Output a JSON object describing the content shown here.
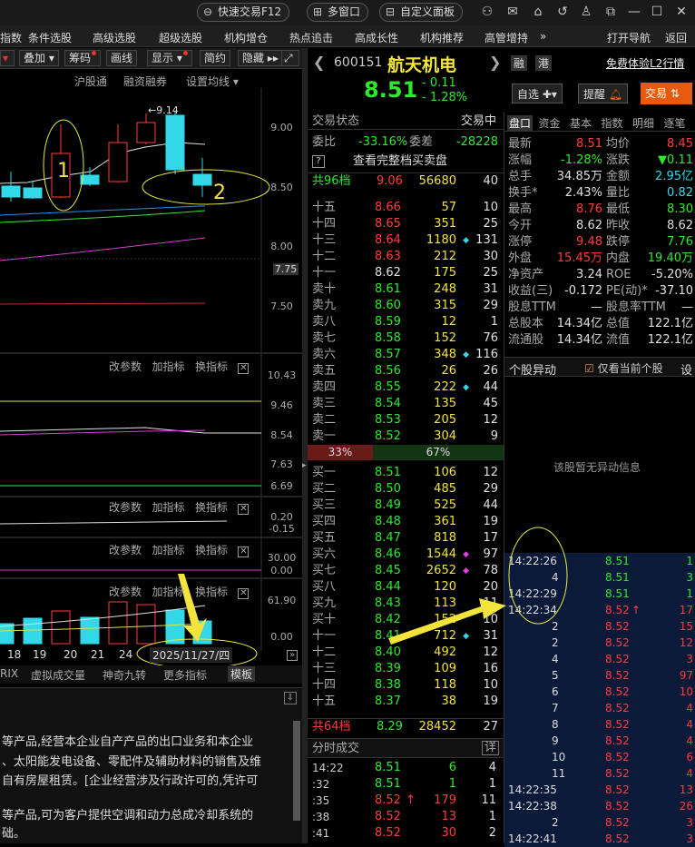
{
  "topbar": {
    "quick_trade": "快速交易F12",
    "multi_window": "多窗口",
    "custom_panel": "自定义面板"
  },
  "menu": [
    "指数",
    "条件选股",
    "高级选股",
    "超级选股",
    "机构增仓",
    "热点追击",
    "高成长性",
    "机构推荐",
    "高管增持",
    "打开导航",
    "返回"
  ],
  "left_toolbar": {
    "overlay": "叠加",
    "chips": "筹码",
    "draw": "画线",
    "display": "显示",
    "simple": "简约",
    "hide": "隐藏"
  },
  "chart_header": {
    "hgt": "沪股通",
    "margin": "融资融券",
    "set_ma": "设置均线"
  },
  "chart_data": [
    {
      "type": "candlestick",
      "y_ticks": [
        "9.00",
        "8.50",
        "8.00",
        "7.75",
        "7.50"
      ],
      "high_label": "9.14",
      "annotations": [
        "1",
        "2"
      ]
    },
    {
      "type": "line",
      "y_ticks": [
        "10.43",
        "9.46",
        "8.54",
        "7.63",
        "6.69"
      ]
    },
    {
      "type": "line",
      "y_ticks": [
        "0.20",
        "-0.15"
      ]
    },
    {
      "type": "line",
      "y_ticks": [
        "30.00",
        "0.00"
      ]
    },
    {
      "type": "bar",
      "y_ticks": [
        "61.90",
        "0.00"
      ],
      "x_ticks": [
        "18",
        "19",
        "20",
        "21",
        "24"
      ],
      "date_label": "2025/11/27/四"
    }
  ],
  "indicator_panel": {
    "change_param": "改参数",
    "add_indicator": "加指标",
    "switch_indicator": "换指标"
  },
  "bottom_tabs": [
    "RIX",
    "虚拟成交量",
    "神奇九转",
    "更多指标",
    "模板"
  ],
  "info_lines": [
    "等产品,经营本企业自产产品的出口业务和本企业",
    "、太阳能发电设备、零配件及辅助材料的销售及维",
    "自有房屋租赁。[企业经营涉及行政许可的,凭许可",
    "等产品,可为客户提供空调和动力总成冷却系统的",
    "础。"
  ],
  "stock": {
    "code": "600151",
    "name": "航天机电",
    "price": "8.51",
    "change": "- 0.11",
    "pct": "- 1.28%",
    "rong": "融",
    "gang": "港",
    "l2": "免费体验L2行情",
    "zixuan": "自选",
    "tixing": "提醒",
    "jiaoyi": "交易"
  },
  "quote_header": {
    "state_label": "交易状态",
    "state": "交易中",
    "weibi_label": "委比",
    "weibi": "-33.16%",
    "weicha_label": "委差",
    "weicha": "-28228",
    "full_depth": "查看完整档买卖盘",
    "top_label": "共96档",
    "top_price": "9.06",
    "top_vol": "56680",
    "top_n": "40"
  },
  "sells": [
    {
      "l": "十五",
      "p": "8.66",
      "v": "57",
      "n": "10",
      "m": ""
    },
    {
      "l": "十四",
      "p": "8.65",
      "v": "351",
      "n": "25",
      "m": ""
    },
    {
      "l": "十三",
      "p": "8.64",
      "v": "1180",
      "n": "131",
      "m": "c"
    },
    {
      "l": "十二",
      "p": "8.63",
      "v": "212",
      "n": "30",
      "m": ""
    },
    {
      "l": "十一",
      "p": "8.62",
      "v": "175",
      "n": "25",
      "m": ""
    },
    {
      "l": "卖十",
      "p": "8.61",
      "v": "248",
      "n": "31",
      "m": ""
    },
    {
      "l": "卖九",
      "p": "8.60",
      "v": "315",
      "n": "29",
      "m": ""
    },
    {
      "l": "卖八",
      "p": "8.59",
      "v": "12",
      "n": "1",
      "m": ""
    },
    {
      "l": "卖七",
      "p": "8.58",
      "v": "152",
      "n": "76",
      "m": ""
    },
    {
      "l": "卖六",
      "p": "8.57",
      "v": "348",
      "n": "116",
      "m": "c"
    },
    {
      "l": "卖五",
      "p": "8.56",
      "v": "26",
      "n": "26",
      "m": ""
    },
    {
      "l": "卖四",
      "p": "8.55",
      "v": "222",
      "n": "44",
      "m": "c"
    },
    {
      "l": "卖三",
      "p": "8.54",
      "v": "135",
      "n": "45",
      "m": ""
    },
    {
      "l": "卖二",
      "p": "8.53",
      "v": "205",
      "n": "12",
      "m": ""
    },
    {
      "l": "卖一",
      "p": "8.52",
      "v": "304",
      "n": "9",
      "m": ""
    }
  ],
  "ratio": {
    "buy": "33%",
    "sell": "67%"
  },
  "buys": [
    {
      "l": "买一",
      "p": "8.51",
      "v": "106",
      "n": "12",
      "m": ""
    },
    {
      "l": "买二",
      "p": "8.50",
      "v": "485",
      "n": "29",
      "m": ""
    },
    {
      "l": "买三",
      "p": "8.49",
      "v": "525",
      "n": "44",
      "m": ""
    },
    {
      "l": "买四",
      "p": "8.48",
      "v": "361",
      "n": "19",
      "m": ""
    },
    {
      "l": "买五",
      "p": "8.47",
      "v": "818",
      "n": "17",
      "m": ""
    },
    {
      "l": "买六",
      "p": "8.46",
      "v": "1544",
      "n": "97",
      "m": "m"
    },
    {
      "l": "买七",
      "p": "8.45",
      "v": "2652",
      "n": "78",
      "m": "m"
    },
    {
      "l": "买八",
      "p": "8.44",
      "v": "120",
      "n": "20",
      "m": ""
    },
    {
      "l": "买九",
      "p": "8.43",
      "v": "113",
      "n": "11",
      "m": ""
    },
    {
      "l": "买十",
      "p": "8.42",
      "v": "152",
      "n": "10",
      "m": ""
    },
    {
      "l": "十一",
      "p": "8.41",
      "v": "712",
      "n": "31",
      "m": "c"
    },
    {
      "l": "十二",
      "p": "8.40",
      "v": "492",
      "n": "12",
      "m": ""
    },
    {
      "l": "十三",
      "p": "8.39",
      "v": "109",
      "n": "16",
      "m": ""
    },
    {
      "l": "十四",
      "p": "8.38",
      "v": "118",
      "n": "10",
      "m": ""
    },
    {
      "l": "十五",
      "p": "8.37",
      "v": "38",
      "n": "19",
      "m": ""
    }
  ],
  "bottom_level": {
    "label": "共64档",
    "price": "8.29",
    "vol": "28452",
    "n": "27"
  },
  "fenshi": {
    "title": "分时成交",
    "detail": "详",
    "rows": [
      {
        "t": "14:22",
        "p": "8.51",
        "v": "6",
        "n": "4",
        "arrow": ""
      },
      {
        "t": ":32",
        "p": "8.51",
        "v": "1",
        "n": "1",
        "arrow": ""
      },
      {
        "t": ":35",
        "p": "8.52",
        "v": "179",
        "n": "11",
        "arrow": "↑"
      },
      {
        "t": ":38",
        "p": "8.52",
        "v": "13",
        "n": "1",
        "arrow": ""
      },
      {
        "t": ":41",
        "p": "8.52",
        "v": "30",
        "n": "2",
        "arrow": ""
      }
    ]
  },
  "rtabs": [
    "盘口",
    "资金",
    "基本",
    "指数",
    "明细",
    "逐笔"
  ],
  "pankou": [
    {
      "a": "最新",
      "av": "8.51",
      "ac": "red",
      "b": "均价",
      "bv": "8.45",
      "bc": "red"
    },
    {
      "a": "涨幅",
      "av": "-1.28%",
      "ac": "grn",
      "b": "涨跌",
      "bv": "▼0.11",
      "bc": "grn"
    },
    {
      "a": "总手",
      "av": "34.85万",
      "ac": "wht",
      "b": "金额",
      "bv": "2.95亿",
      "bc": "cyan"
    },
    {
      "a": "换手*",
      "av": "2.43%",
      "ac": "wht",
      "b": "量比",
      "bv": "0.82",
      "bc": "cyan"
    },
    {
      "a": "最高",
      "av": "8.76",
      "ac": "red",
      "b": "最低",
      "bv": "8.30",
      "bc": "grn"
    },
    {
      "a": "今开",
      "av": "8.62",
      "ac": "wht",
      "b": "昨收",
      "bv": "8.62",
      "bc": "wht"
    },
    {
      "a": "涨停",
      "av": "9.48",
      "ac": "red",
      "b": "跌停",
      "bv": "7.76",
      "bc": "grn"
    },
    {
      "a": "外盘",
      "av": "15.45万",
      "ac": "red",
      "b": "内盘",
      "bv": "19.40万",
      "bc": "grn"
    },
    {
      "a": "净资产",
      "av": "3.24",
      "ac": "wht",
      "b": "ROE",
      "bv": "-5.20%",
      "bc": "wht"
    },
    {
      "a": "收益(三)",
      "av": "-0.172",
      "ac": "wht",
      "b": "PE(动)*",
      "bv": "-37.10",
      "bc": "wht"
    },
    {
      "a": "股息TTM",
      "av": "—",
      "ac": "wht",
      "b": "股息率TTM",
      "bv": "—",
      "bc": "wht"
    },
    {
      "a": "总股本",
      "av": "14.34亿",
      "ac": "wht",
      "b": "总值",
      "bv": "122.1亿",
      "bc": "wht"
    },
    {
      "a": "流通股",
      "av": "14.34亿",
      "ac": "wht",
      "b": "流值",
      "bv": "122.1亿",
      "bc": "wht"
    }
  ],
  "yidong": {
    "title": "个股异动",
    "only_current": "仅看当前个股",
    "settings": "设",
    "empty": "该股暂无异动信息"
  },
  "ticks": [
    {
      "t": "14:22:26",
      "p": "8.51",
      "a": "",
      "v": "1"
    },
    {
      "t": "4",
      "p": "8.51",
      "a": "",
      "v": "3"
    },
    {
      "t": "14:22:29",
      "p": "8.51",
      "a": "",
      "v": "1"
    },
    {
      "t": "14:22:34",
      "p": "8.52",
      "a": "↑",
      "v": "17"
    },
    {
      "t": "2",
      "p": "8.52",
      "a": "",
      "v": "15"
    },
    {
      "t": "2",
      "p": "8.52",
      "a": "",
      "v": "12"
    },
    {
      "t": "4",
      "p": "8.52",
      "a": "",
      "v": "3"
    },
    {
      "t": "5",
      "p": "8.52",
      "a": "",
      "v": "97"
    },
    {
      "t": "6",
      "p": "8.52",
      "a": "",
      "v": "10"
    },
    {
      "t": "7",
      "p": "8.52",
      "a": "",
      "v": "4"
    },
    {
      "t": "8",
      "p": "8.52",
      "a": "",
      "v": "4"
    },
    {
      "t": "9",
      "p": "8.52",
      "a": "",
      "v": "4"
    },
    {
      "t": "10",
      "p": "8.52",
      "a": "",
      "v": "6"
    },
    {
      "t": "11",
      "p": "8.52",
      "a": "",
      "v": "4"
    },
    {
      "t": "14:22:35",
      "p": "8.52",
      "a": "",
      "v": "13"
    },
    {
      "t": "14:22:38",
      "p": "8.52",
      "a": "",
      "v": "26"
    },
    {
      "t": "2",
      "p": "8.52",
      "a": "",
      "v": "3"
    },
    {
      "t": "14:22:41",
      "p": "8.52",
      "a": "",
      "v": "3"
    }
  ]
}
